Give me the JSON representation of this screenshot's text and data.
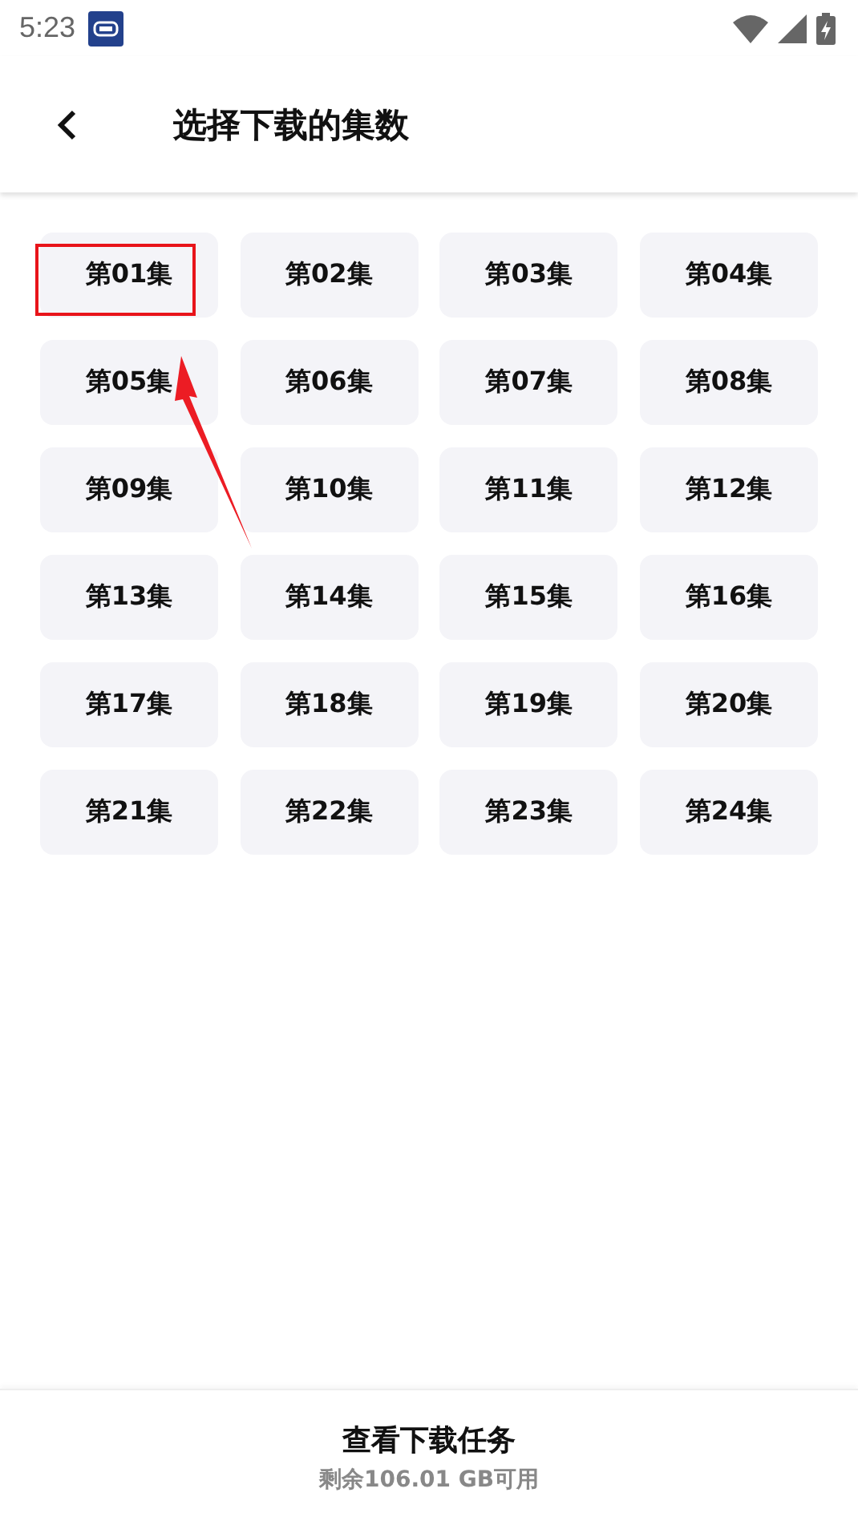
{
  "status_bar": {
    "time": "5:23"
  },
  "header": {
    "title": "选择下载的集数"
  },
  "episodes": [
    {
      "label": "第01集",
      "highlighted": true
    },
    {
      "label": "第02集",
      "highlighted": false
    },
    {
      "label": "第03集",
      "highlighted": false
    },
    {
      "label": "第04集",
      "highlighted": false
    },
    {
      "label": "第05集",
      "highlighted": false
    },
    {
      "label": "第06集",
      "highlighted": false
    },
    {
      "label": "第07集",
      "highlighted": false
    },
    {
      "label": "第08集",
      "highlighted": false
    },
    {
      "label": "第09集",
      "highlighted": false
    },
    {
      "label": "第10集",
      "highlighted": false
    },
    {
      "label": "第11集",
      "highlighted": false
    },
    {
      "label": "第12集",
      "highlighted": false
    },
    {
      "label": "第13集",
      "highlighted": false
    },
    {
      "label": "第14集",
      "highlighted": false
    },
    {
      "label": "第15集",
      "highlighted": false
    },
    {
      "label": "第16集",
      "highlighted": false
    },
    {
      "label": "第17集",
      "highlighted": false
    },
    {
      "label": "第18集",
      "highlighted": false
    },
    {
      "label": "第19集",
      "highlighted": false
    },
    {
      "label": "第20集",
      "highlighted": false
    },
    {
      "label": "第21集",
      "highlighted": false
    },
    {
      "label": "第22集",
      "highlighted": false
    },
    {
      "label": "第23集",
      "highlighted": false
    },
    {
      "label": "第24集",
      "highlighted": false
    }
  ],
  "footer": {
    "button": "查看下载任务",
    "storage": "剩余106.01 GB可用"
  }
}
